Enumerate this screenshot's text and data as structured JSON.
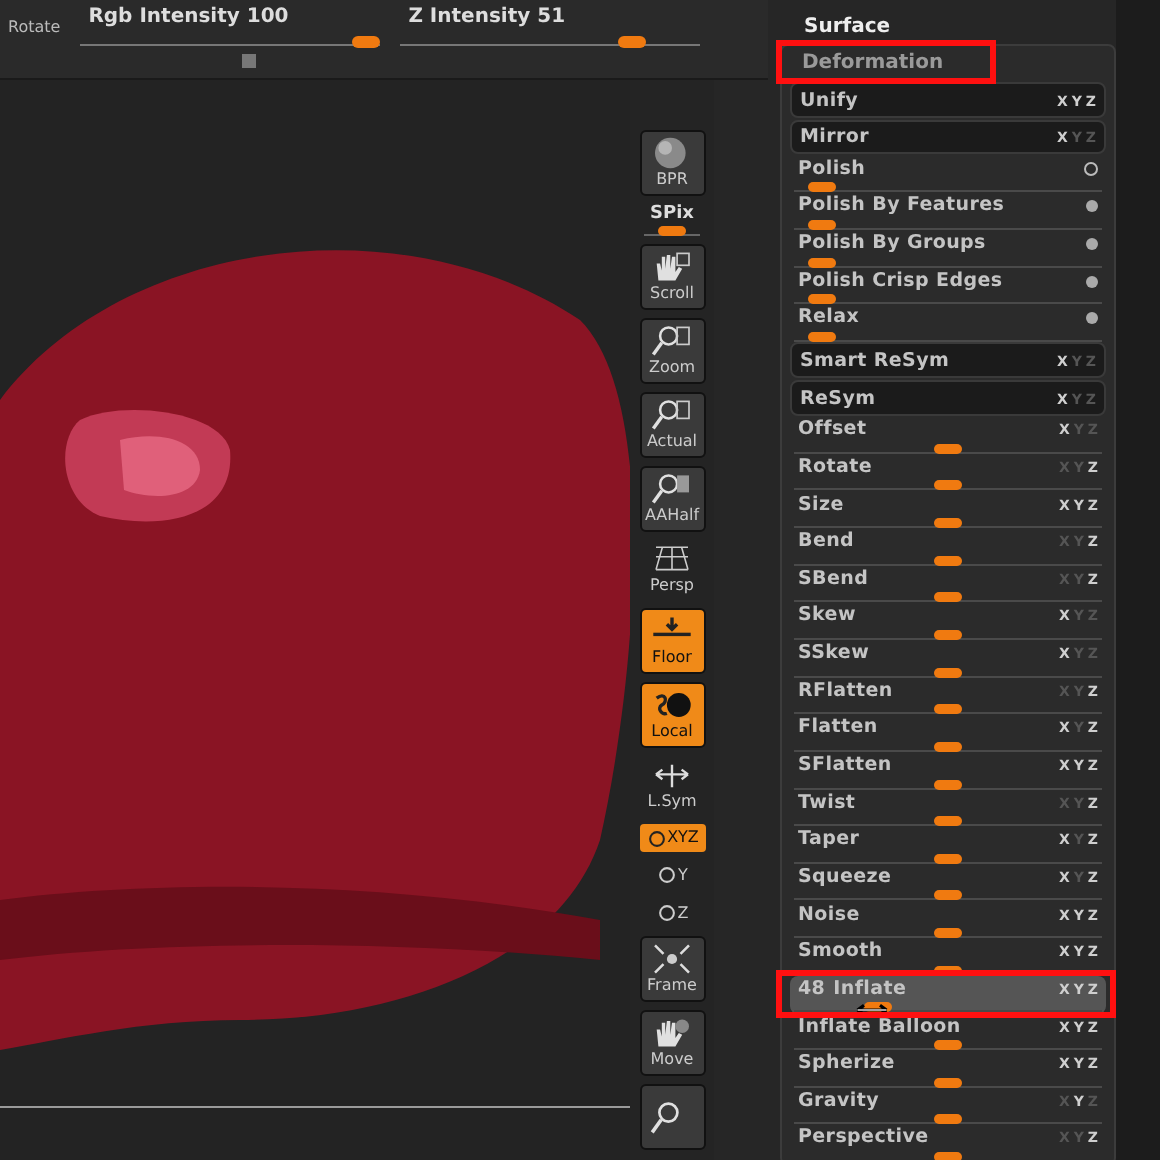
{
  "top_bar": {
    "label": "Rotate",
    "sliders": [
      {
        "label": "Rgb Intensity 100",
        "level": 1
      },
      {
        "label": "Z Intensity 51",
        "level": 0.8
      }
    ]
  },
  "toolbar": [
    {
      "kind": "button",
      "label": "BPR",
      "on": false
    },
    {
      "kind": "slider",
      "label": "SPix",
      "level": 0.5
    },
    {
      "kind": "button",
      "label": "Scroll",
      "on": false
    },
    {
      "kind": "button",
      "label": "Zoom",
      "on": false
    },
    {
      "kind": "button",
      "label": "Actual",
      "on": false
    },
    {
      "kind": "button",
      "label": "AAHalf",
      "on": false
    },
    {
      "kind": "flat",
      "label": "Persp",
      "on": false
    },
    {
      "kind": "button",
      "label": "Floor",
      "on": true
    },
    {
      "kind": "button",
      "label": "Local",
      "on": true
    },
    {
      "kind": "flat",
      "label": "L.Sym",
      "on": false
    },
    {
      "kind": "toggle",
      "label": "XYZ",
      "on": true
    },
    {
      "kind": "small",
      "label": "Y",
      "on": false
    },
    {
      "kind": "small",
      "label": "Z",
      "on": false
    },
    {
      "kind": "button",
      "label": "Frame",
      "on": false
    },
    {
      "kind": "button",
      "label": "Move",
      "on": false
    },
    {
      "kind": "button",
      "on": false
    }
  ],
  "panel": {
    "title": "Surface",
    "section": {
      "title": "Deformation",
      "highlighted": true,
      "rows": [
        {
          "kind": "button",
          "label": "Unify",
          "axes": [
            {
              "label": "X",
              "on": true
            },
            {
              "label": "Y",
              "on": true
            },
            {
              "label": "Z",
              "on": true
            }
          ]
        },
        {
          "kind": "button",
          "label": "Mirror",
          "axes": [
            {
              "label": "X",
              "on": true
            },
            {
              "label": "Y",
              "on": false
            },
            {
              "label": "Z",
              "on": false
            }
          ]
        },
        {
          "kind": "toggle",
          "label": "Polish",
          "filled": false,
          "level": 0.05
        },
        {
          "kind": "toggle",
          "label": "Polish By Features",
          "filled": true,
          "level": 0.05
        },
        {
          "kind": "toggle",
          "label": "Polish By Groups",
          "filled": true,
          "level": 0.05
        },
        {
          "kind": "toggle",
          "label": "Polish Crisp Edges",
          "filled": true,
          "level": 0.05
        },
        {
          "kind": "toggle",
          "label": "Relax",
          "filled": true,
          "level": 0.05
        },
        {
          "kind": "button",
          "label": "Smart ReSym",
          "axes": [
            {
              "label": "X",
              "on": true
            },
            {
              "label": "Y",
              "on": false
            },
            {
              "label": "Z",
              "on": false
            }
          ]
        },
        {
          "kind": "button",
          "label": "ReSym",
          "axes": [
            {
              "label": "X",
              "on": true
            },
            {
              "label": "Y",
              "on": false
            },
            {
              "label": "Z",
              "on": false
            }
          ]
        },
        {
          "kind": "slider",
          "label": "Offset",
          "level": 0.5,
          "axes": [
            {
              "label": "X",
              "on": true
            },
            {
              "label": "Y",
              "on": false
            },
            {
              "label": "Z",
              "on": false
            }
          ]
        },
        {
          "kind": "slider",
          "label": "Rotate",
          "level": 0.5,
          "axes": [
            {
              "label": "X",
              "on": false
            },
            {
              "label": "Y",
              "on": false
            },
            {
              "label": "Z",
              "on": true
            }
          ]
        },
        {
          "kind": "slider",
          "label": "Size",
          "level": 0.5,
          "axes": [
            {
              "label": "X",
              "on": true
            },
            {
              "label": "Y",
              "on": true
            },
            {
              "label": "Z",
              "on": true
            }
          ]
        },
        {
          "kind": "slider",
          "label": "Bend",
          "level": 0.5,
          "axes": [
            {
              "label": "X",
              "on": false
            },
            {
              "label": "Y",
              "on": false
            },
            {
              "label": "Z",
              "on": true
            }
          ]
        },
        {
          "kind": "slider",
          "label": "SBend",
          "level": 0.5,
          "axes": [
            {
              "label": "X",
              "on": false
            },
            {
              "label": "Y",
              "on": false
            },
            {
              "label": "Z",
              "on": true
            }
          ]
        },
        {
          "kind": "slider",
          "label": "Skew",
          "level": 0.5,
          "axes": [
            {
              "label": "X",
              "on": true
            },
            {
              "label": "Y",
              "on": false
            },
            {
              "label": "Z",
              "on": false
            }
          ]
        },
        {
          "kind": "slider",
          "label": "SSkew",
          "level": 0.5,
          "axes": [
            {
              "label": "X",
              "on": true
            },
            {
              "label": "Y",
              "on": false
            },
            {
              "label": "Z",
              "on": false
            }
          ]
        },
        {
          "kind": "slider",
          "label": "RFlatten",
          "level": 0.5,
          "axes": [
            {
              "label": "X",
              "on": false
            },
            {
              "label": "Y",
              "on": false
            },
            {
              "label": "Z",
              "on": true
            }
          ]
        },
        {
          "kind": "slider",
          "label": "Flatten",
          "level": 0.5,
          "axes": [
            {
              "label": "X",
              "on": true
            },
            {
              "label": "Y",
              "on": false
            },
            {
              "label": "Z",
              "on": true
            }
          ]
        },
        {
          "kind": "slider",
          "label": "SFlatten",
          "level": 0.5,
          "axes": [
            {
              "label": "X",
              "on": true
            },
            {
              "label": "Y",
              "on": true
            },
            {
              "label": "Z",
              "on": true
            }
          ]
        },
        {
          "kind": "slider",
          "label": "Twist",
          "level": 0.5,
          "axes": [
            {
              "label": "X",
              "on": false
            },
            {
              "label": "Y",
              "on": false
            },
            {
              "label": "Z",
              "on": true
            }
          ]
        },
        {
          "kind": "slider",
          "label": "Taper",
          "level": 0.5,
          "axes": [
            {
              "label": "X",
              "on": true
            },
            {
              "label": "Y",
              "on": false
            },
            {
              "label": "Z",
              "on": true
            }
          ]
        },
        {
          "kind": "slider",
          "label": "Squeeze",
          "level": 0.5,
          "axes": [
            {
              "label": "X",
              "on": true
            },
            {
              "label": "Y",
              "on": false
            },
            {
              "label": "Z",
              "on": true
            }
          ]
        },
        {
          "kind": "slider",
          "label": "Noise",
          "level": 0.5,
          "axes": [
            {
              "label": "X",
              "on": true
            },
            {
              "label": "Y",
              "on": true
            },
            {
              "label": "Z",
              "on": true
            }
          ]
        },
        {
          "kind": "slider",
          "label": "Smooth",
          "level": 0.5,
          "axes": [
            {
              "label": "X",
              "on": true
            },
            {
              "label": "Y",
              "on": true
            },
            {
              "label": "Z",
              "on": true
            }
          ]
        },
        {
          "kind": "slider",
          "label": "Inflate",
          "value": "48",
          "active": true,
          "highlighted": true,
          "level": 0.25,
          "axes": [
            {
              "label": "X",
              "on": true
            },
            {
              "label": "Y",
              "on": true
            },
            {
              "label": "Z",
              "on": true
            }
          ]
        },
        {
          "kind": "slider",
          "label": "Inflate Balloon",
          "level": 0.5,
          "axes": [
            {
              "label": "X",
              "on": true
            },
            {
              "label": "Y",
              "on": true
            },
            {
              "label": "Z",
              "on": true
            }
          ]
        },
        {
          "kind": "slider",
          "label": "Spherize",
          "level": 0.5,
          "axes": [
            {
              "label": "X",
              "on": true
            },
            {
              "label": "Y",
              "on": true
            },
            {
              "label": "Z",
              "on": true
            }
          ]
        },
        {
          "kind": "slider",
          "label": "Gravity",
          "level": 0.5,
          "axes": [
            {
              "label": "X",
              "on": false
            },
            {
              "label": "Y",
              "on": true
            },
            {
              "label": "Z",
              "on": false
            }
          ]
        },
        {
          "kind": "slider",
          "label": "Perspective",
          "level": 0.5,
          "axes": [
            {
              "label": "X",
              "on": false
            },
            {
              "label": "Y",
              "on": false
            },
            {
              "label": "Z",
              "on": true
            }
          ]
        }
      ]
    }
  }
}
